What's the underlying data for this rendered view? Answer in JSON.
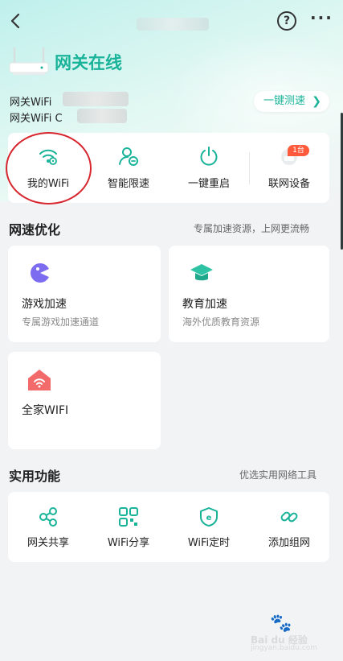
{
  "colors": {
    "accent": "#19b399",
    "badge": "#ff5a3c",
    "annotation": "#d8262f"
  },
  "header": {
    "help_label": "?",
    "more_label": "···"
  },
  "gateway": {
    "status": "网关在线",
    "wifi_line_1": "网关WiFi",
    "wifi_line_2": "网关WiFi  C",
    "speed_test_label": "一键测速",
    "speed_test_icon": "chevron-right-icon"
  },
  "quick_actions": [
    {
      "label": "我的WiFi",
      "icon": "wifi-settings-icon"
    },
    {
      "label": "智能限速",
      "icon": "user-speed-icon"
    },
    {
      "label": "一键重启",
      "icon": "power-icon"
    },
    {
      "label": "联网设备",
      "icon": "device-icon",
      "badge": "1台"
    }
  ],
  "speed_optimize": {
    "title": "网速优化",
    "subtitle": "专属加速资源，上网更流畅",
    "cards": [
      {
        "title": "游戏加速",
        "desc": "专属游戏加速通道",
        "icon": "game-icon"
      },
      {
        "title": "教育加速",
        "desc": "海外优质教育资源",
        "icon": "graduation-cap-icon"
      },
      {
        "title": "全家WIFI",
        "desc": "",
        "icon": "home-wifi-icon"
      }
    ]
  },
  "tools": {
    "title": "实用功能",
    "subtitle": "优选实用网络工具",
    "items": [
      {
        "label": "网关共享",
        "icon": "share-icon"
      },
      {
        "label": "WiFi分享",
        "icon": "qr-code-icon"
      },
      {
        "label": "WiFi定时",
        "icon": "timer-shield-icon"
      },
      {
        "label": "添加组网",
        "icon": "link-icon"
      }
    ]
  },
  "watermark": {
    "text": "Bai du 经验",
    "url": "jingyan.baidu.com"
  }
}
